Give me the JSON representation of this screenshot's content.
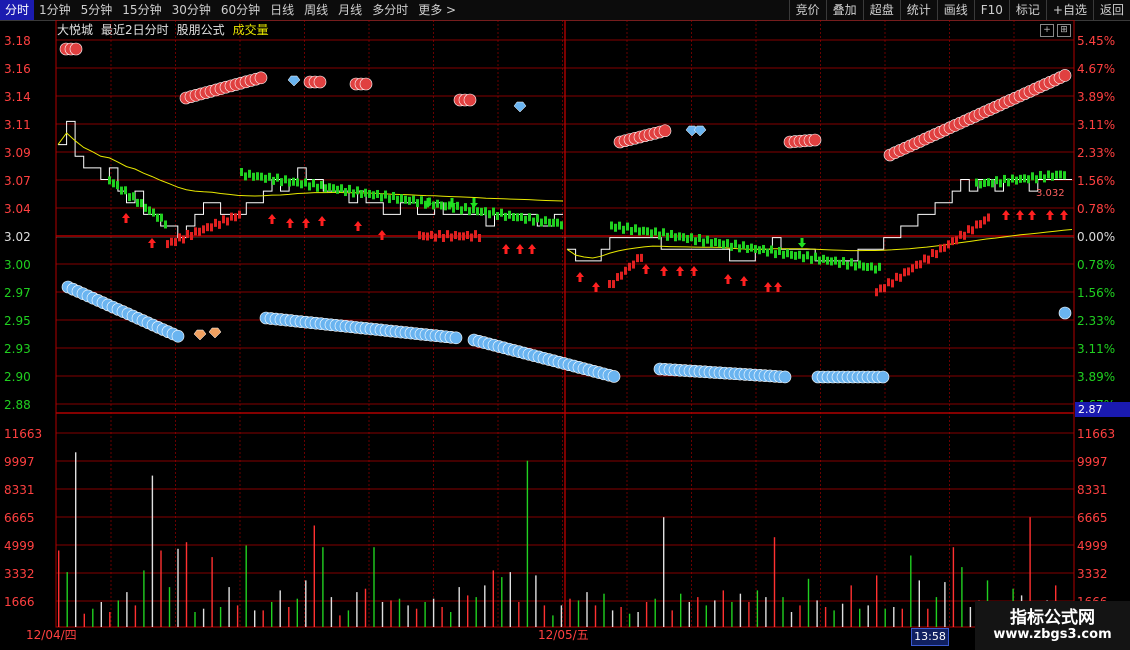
{
  "toolbar": {
    "left_items": [
      "分时",
      "1分钟",
      "5分钟",
      "15分钟",
      "30分钟",
      "60分钟",
      "日线",
      "周线",
      "月线",
      "多分时",
      "更多 >"
    ],
    "active_index": 0,
    "right_items": [
      "竞价",
      "叠加",
      "超盘",
      "统计",
      "画线",
      "F10",
      "标记",
      "+自选",
      "返回"
    ]
  },
  "header": {
    "stock_name": "大悦城",
    "mode": "最近2日分时",
    "formula": "股朋公式",
    "volume_label": "成交量"
  },
  "window_buttons": [
    "+",
    "⊞"
  ],
  "price_axis": {
    "left_labels": [
      "3.18",
      "3.16",
      "3.14",
      "3.11",
      "3.09",
      "3.07",
      "3.04",
      "3.02",
      "3.00",
      "2.97",
      "2.95",
      "2.93",
      "2.90",
      "2.88"
    ],
    "right_labels": [
      "5.45%",
      "4.67%",
      "3.89%",
      "3.11%",
      "2.33%",
      "1.56%",
      "0.78%",
      "0.00%",
      "0.78%",
      "1.56%",
      "2.33%",
      "3.11%",
      "3.89%",
      "4.67%"
    ],
    "current_price": "2.87",
    "colors": {
      "up": "#ff3030",
      "down": "#00d000",
      "flat": "#ffffff"
    }
  },
  "volume_axis": {
    "labels": [
      "11663",
      "9997",
      "8331",
      "6665",
      "4999",
      "3332",
      "1666"
    ]
  },
  "date_axis": {
    "day1": "12/04/四",
    "day2": "12/05/五",
    "cursor_time": "13:58"
  },
  "overlay_text": "3.032",
  "watermark": {
    "title": "指标公式网",
    "url": "www.zbgs3.com"
  },
  "chart_data": {
    "type": "line",
    "days": [
      "12/04/四",
      "12/05/五"
    ],
    "ylim": [
      2.87,
      3.19
    ],
    "reference_price": 3.02,
    "price_series": {
      "name": "",
      "points_day1": [
        3.1,
        3.12,
        3.09,
        3.08,
        3.08,
        3.07,
        3.08,
        3.06,
        3.05,
        3.06,
        3.04,
        3.04,
        3.03,
        3.03,
        3.02,
        3.03,
        3.04,
        3.05,
        3.05,
        3.04,
        3.04,
        3.04,
        3.05,
        3.05,
        3.06,
        3.07,
        3.06,
        3.07,
        3.08,
        3.07,
        3.07,
        3.06,
        3.06,
        3.06,
        3.05,
        3.06,
        3.05,
        3.05,
        3.04,
        3.04,
        3.05,
        3.05,
        3.04,
        3.04,
        3.05,
        3.04,
        3.04,
        3.04,
        3.04,
        3.04,
        3.03,
        3.04,
        3.04,
        3.04,
        3.04,
        3.04,
        3.03,
        3.03,
        3.04,
        3.04
      ],
      "points_day2": [
        3.01,
        3.0,
        3.0,
        3.0,
        3.01,
        3.02,
        3.02,
        3.02,
        3.02,
        3.02,
        3.02,
        3.01,
        3.01,
        3.01,
        3.01,
        3.01,
        3.01,
        3.01,
        3.01,
        3.0,
        3.0,
        3.0,
        3.01,
        3.01,
        3.02,
        3.01,
        3.01,
        3.01,
        3.01,
        3.0,
        3.0,
        3.0,
        3.0,
        3.0,
        3.01,
        3.01,
        3.01,
        3.02,
        3.02,
        3.03,
        3.03,
        3.04,
        3.04,
        3.05,
        3.05,
        3.06,
        3.07,
        3.06,
        3.07,
        3.07,
        3.06,
        3.07,
        3.07,
        3.07,
        3.06,
        3.07,
        3.07,
        3.07,
        3.07,
        3.07
      ]
    },
    "volume_series": {
      "name": "",
      "values": [
        4600,
        3300,
        10500,
        800,
        1100,
        1500,
        900,
        1600,
        2100,
        1300,
        3400,
        9100,
        4600,
        2400,
        4700,
        5100,
        900,
        1100,
        4200,
        1200,
        2400,
        1300,
        4900,
        1000,
        1000,
        1500,
        2200,
        1200,
        1700,
        2800,
        6100,
        4800,
        1800,
        700,
        1000,
        2100,
        2300,
        4800,
        1500,
        1600,
        1700,
        1300,
        1100,
        1500,
        1700,
        1200,
        900,
        2400,
        1900,
        1800,
        2500,
        3400,
        3000,
        3300,
        1500,
        10000,
        3100,
        1300,
        700,
        1300,
        1700,
        1600,
        2100,
        1300,
        2000,
        1000,
        1200,
        800,
        900,
        1500,
        1700,
        6600,
        1000,
        2000,
        1500,
        1800,
        1300,
        1600,
        2200,
        1500,
        2000,
        1500,
        2200,
        1800,
        5400,
        1800,
        900,
        1300,
        2900,
        1600,
        1200,
        1000,
        1400,
        2500,
        1100,
        1300,
        3100,
        1100,
        1200,
        1100,
        4300,
        2800,
        1100,
        1800,
        2700,
        4800,
        3600,
        1200,
        1600,
        2800,
        900,
        1000,
        2300,
        1900,
        6600,
        800,
        1600,
        2500,
        1500
      ]
    }
  }
}
